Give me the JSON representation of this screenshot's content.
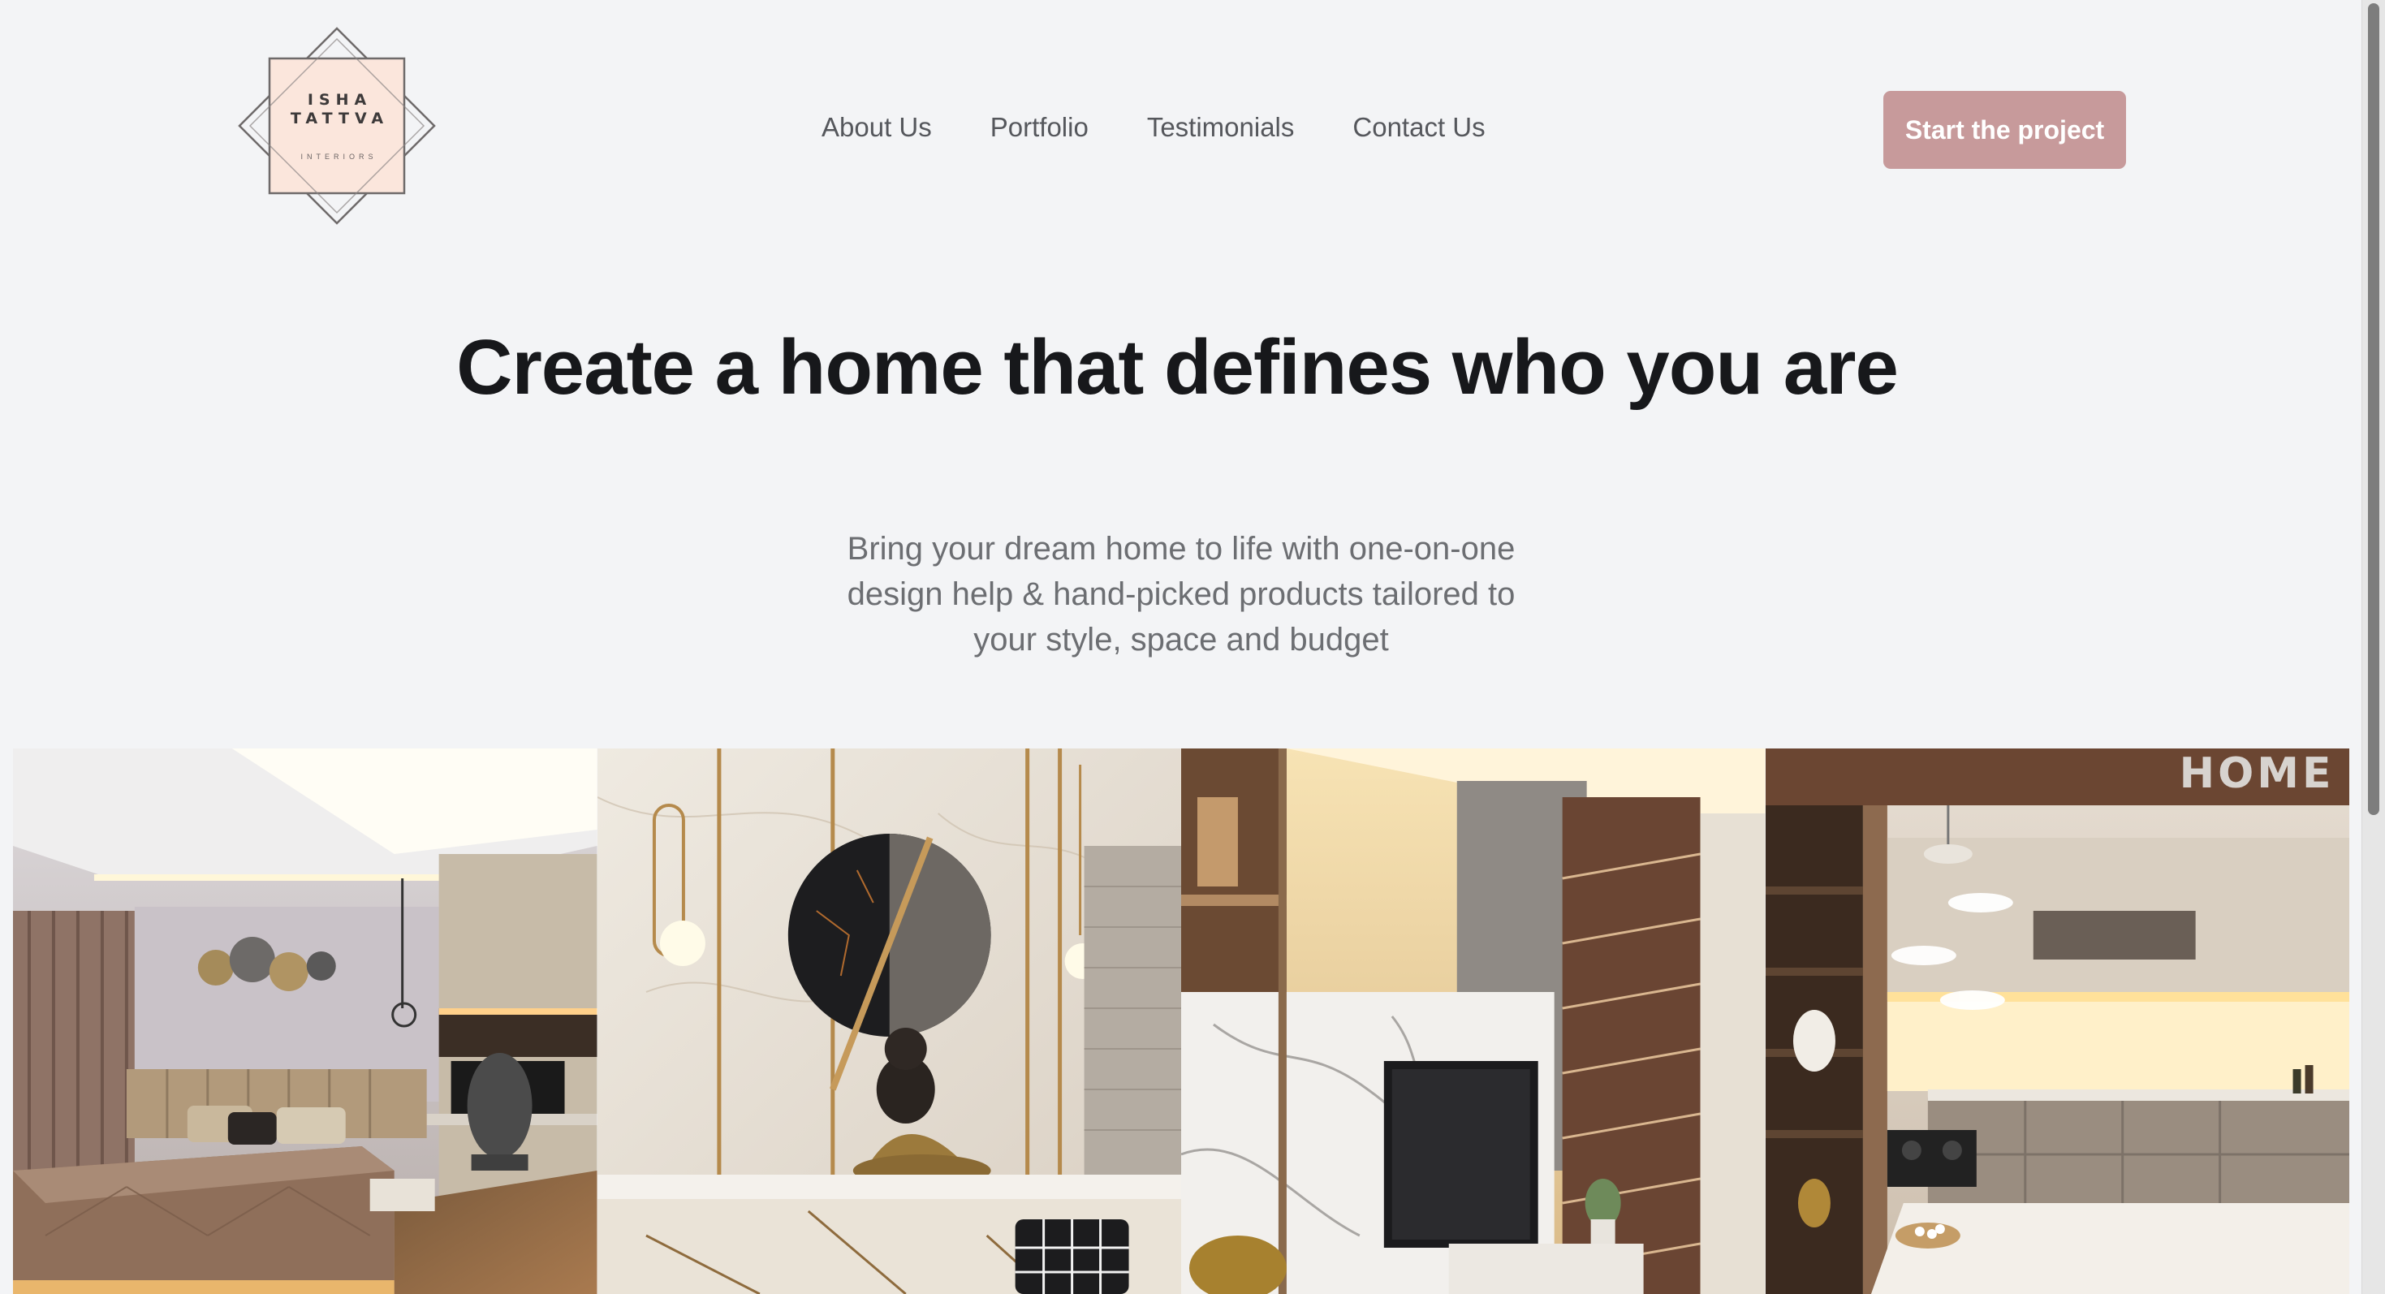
{
  "brand": {
    "line1": "ISHA",
    "line2": "TATTVA",
    "sub": "INTERIORS"
  },
  "nav": {
    "items": [
      {
        "label": "About Us"
      },
      {
        "label": "Portfolio"
      },
      {
        "label": "Testimonials"
      },
      {
        "label": "Contact Us"
      }
    ]
  },
  "cta": {
    "label": "Start the project"
  },
  "hero": {
    "title": "Create a home that defines who you are",
    "subtitle_line1": "Bring your dream home to life with one-on-one",
    "subtitle_line2": "design help & hand-picked products tailored to",
    "subtitle_line3": "your style, space and budget"
  },
  "gallery": {
    "photos": [
      {
        "subject": "bedroom"
      },
      {
        "subject": "living-room-wall"
      },
      {
        "subject": "tv-wall"
      },
      {
        "subject": "kitchen"
      }
    ]
  },
  "colors": {
    "background": "#f3f4f6",
    "cta": "#c79a9b",
    "title": "#17181b",
    "nav": "#55575c",
    "subtitle": "#6c6e72",
    "logo_fill": "#fbe6dc"
  }
}
